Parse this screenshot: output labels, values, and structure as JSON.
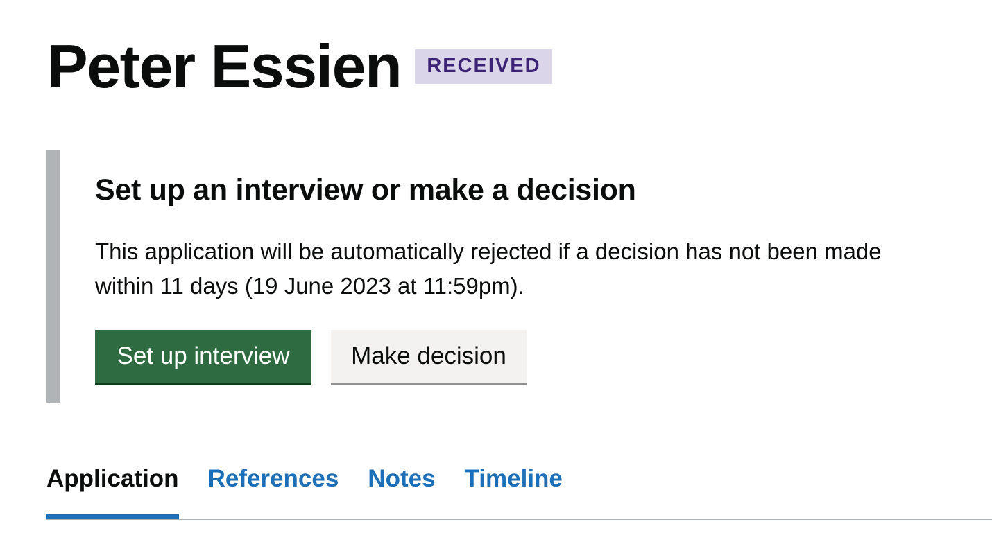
{
  "header": {
    "title": "Peter Essien",
    "status": "RECEIVED"
  },
  "decision_panel": {
    "heading": "Set up an interview or make a decision",
    "body": "This application will be automatically rejected if a decision has not been made within 11 days (19 June 2023 at 11:59pm).",
    "primary_button": "Set up interview",
    "secondary_button": "Make decision"
  },
  "tabs": [
    {
      "label": "Application",
      "active": true
    },
    {
      "label": "References",
      "active": false
    },
    {
      "label": "Notes",
      "active": false
    },
    {
      "label": "Timeline",
      "active": false
    }
  ],
  "colors": {
    "primary_button": "#2e6b41",
    "link": "#1d70b8",
    "badge_background": "#dbd5e9",
    "badge_text": "#3d2375",
    "inset_border": "#b1b4b6"
  }
}
